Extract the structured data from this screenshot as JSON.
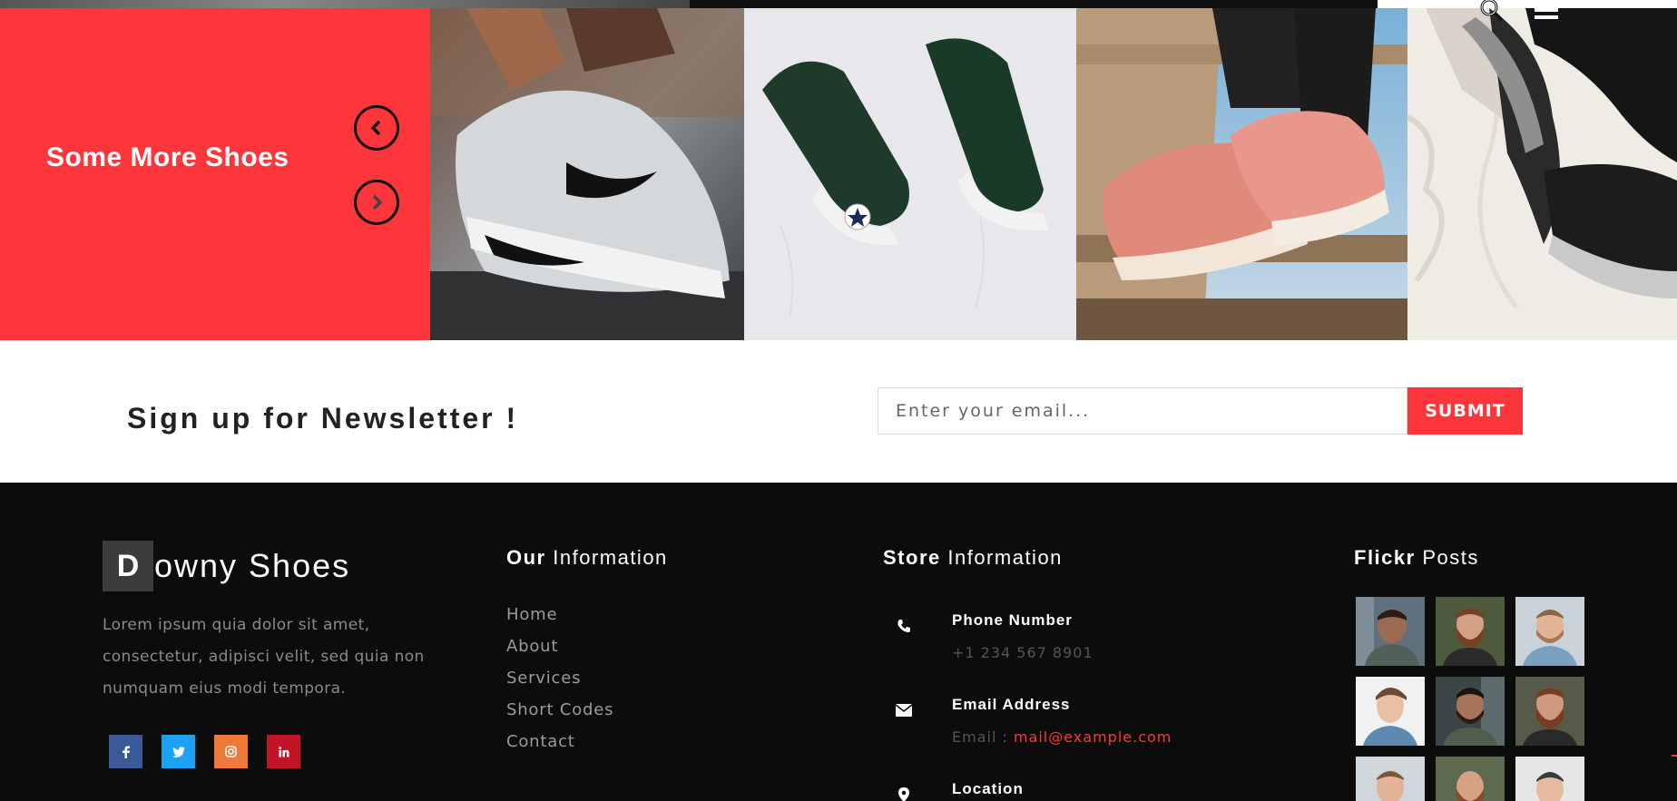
{
  "hero": {
    "title": "Some More Shoes",
    "prev_icon": "chevron-left-icon",
    "next_icon": "chevron-right-icon",
    "accent": "#fc363b"
  },
  "header": {
    "search_icon": "search-icon",
    "menu_icon": "hamburger-menu-icon"
  },
  "newsletter": {
    "title": "Sign up for Newsletter !",
    "placeholder": "Enter your email...",
    "submit_label": "SUBMIT"
  },
  "footer": {
    "brand_initial": "D",
    "brand_rest": "owny Shoes",
    "about": "Lorem ipsum quia dolor sit amet, consectetur, adipisci velit, sed quia non numquam eius modi tempora.",
    "socials": [
      {
        "label": "f",
        "icon": "facebook-icon"
      },
      {
        "label": "t",
        "icon": "twitter-icon"
      },
      {
        "label": "ig",
        "icon": "instagram-icon"
      },
      {
        "label": "in",
        "icon": "linkedin-icon"
      }
    ],
    "info": {
      "title_bold": "Our",
      "title_rest": " Information",
      "links": [
        "Home",
        "About",
        "Services",
        "Short Codes",
        "Contact"
      ]
    },
    "store": {
      "title_bold": "Store",
      "title_rest": " Information",
      "phone_label": "Phone Number",
      "phone_value": "+1 234 567 8901",
      "email_label": "Email Address",
      "email_prefix": "Email : ",
      "email_value": "mail@example.com",
      "location_label": "Location"
    },
    "flickr": {
      "title_bold": "Flickr",
      "title_rest": " Posts"
    }
  }
}
